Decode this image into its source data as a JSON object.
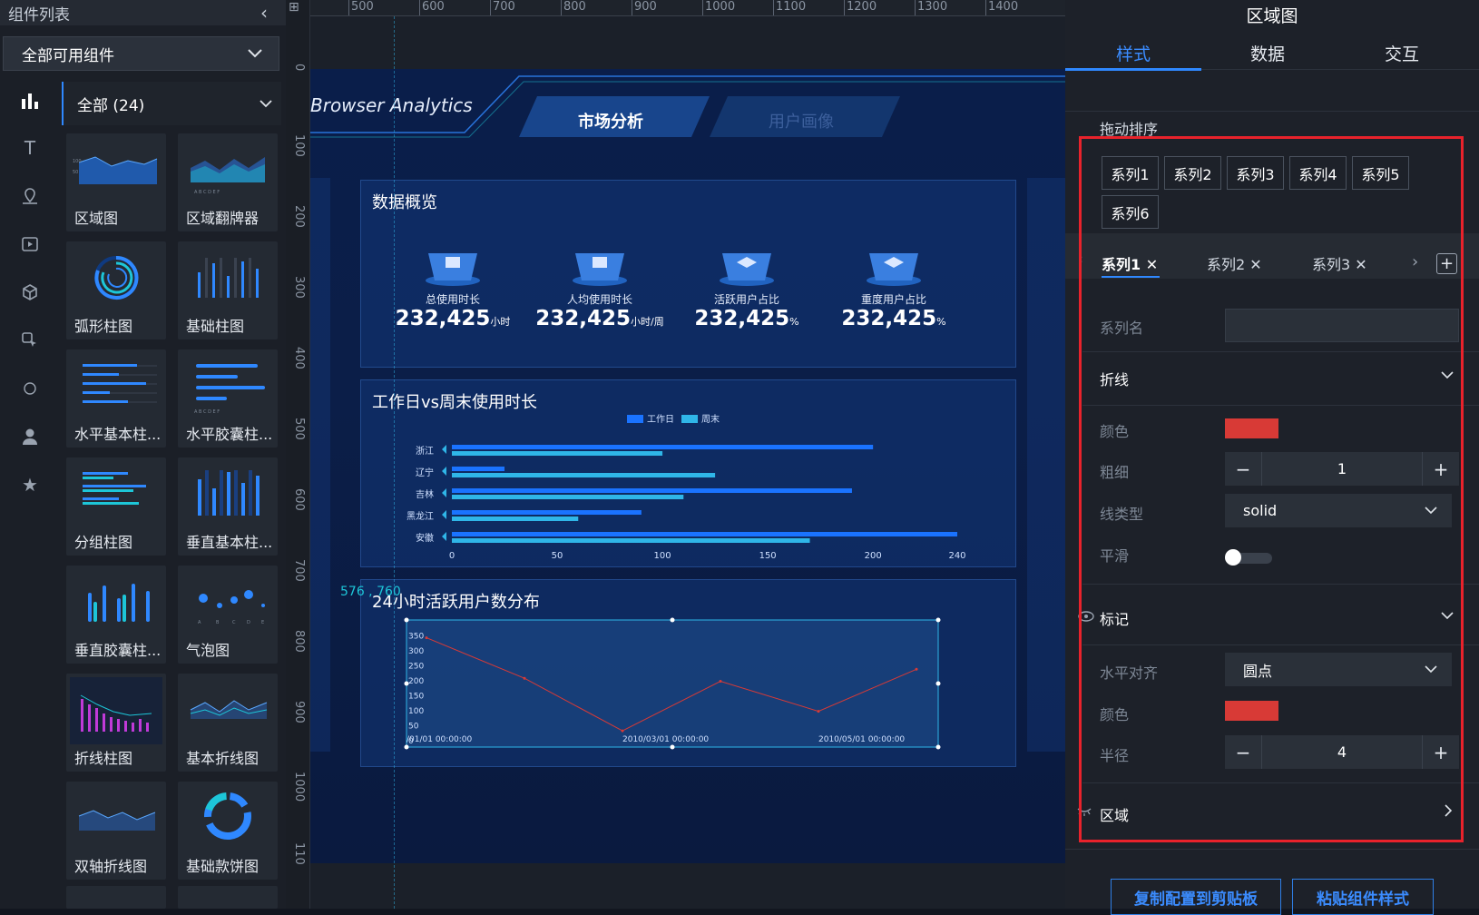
{
  "left": {
    "title": "组件列表",
    "scope_select": "全部可用组件",
    "category_select": "全部 (24)",
    "components": [
      "区域图",
      "区域翻牌器",
      "弧形柱图",
      "基础柱图",
      "水平基本柱...",
      "水平胶囊柱...",
      "分组柱图",
      "垂直基本柱...",
      "垂直胶囊柱...",
      "气泡图",
      "折线柱图",
      "基本折线图",
      "双轴折线图",
      "基础款饼图"
    ],
    "thumb_bubble_axis": [
      "A",
      "B",
      "C",
      "D",
      "E"
    ]
  },
  "ruler": {
    "h": [
      "500",
      "600",
      "700",
      "800",
      "900",
      "1000",
      "1100",
      "1200",
      "1300",
      "1400"
    ],
    "v": [
      "0",
      "100",
      "200",
      "300",
      "400",
      "500",
      "600",
      "700",
      "800",
      "900",
      "1000",
      "110"
    ]
  },
  "canvas": {
    "brand": "Browser Analytics",
    "nav_active": "市场分析",
    "nav_inactive": "用户画像",
    "overview": {
      "title": "数据概览",
      "kpis": [
        {
          "caption": "总使用时长",
          "value": "232,425",
          "unit": "小时"
        },
        {
          "caption": "人均使用时长",
          "value": "232,425",
          "unit": "小时/周"
        },
        {
          "caption": "活跃用户占比",
          "value": "232,425",
          "unit": "%"
        },
        {
          "caption": "重度用户占比",
          "value": "232,425",
          "unit": "%"
        }
      ]
    },
    "bar_title": "工作日vs周末使用时长",
    "line_title": "24小时活跃用户数分布",
    "coord_readout": "576 , 760"
  },
  "chart_data": [
    {
      "type": "bar",
      "title": "工作日vs周末使用时长",
      "orientation": "horizontal",
      "categories": [
        "浙江",
        "辽宁",
        "吉林",
        "黑龙江",
        "安徽"
      ],
      "series": [
        {
          "name": "工作日",
          "values": [
            200,
            25,
            190,
            90,
            240
          ]
        },
        {
          "name": "周末",
          "values": [
            100,
            125,
            110,
            60,
            170
          ]
        }
      ],
      "xticks": [
        "0",
        "50",
        "100",
        "150",
        "200",
        "240"
      ],
      "xlim": [
        0,
        240
      ],
      "legend": "top-center",
      "colors": [
        "#1a73ff",
        "#2fb6e8"
      ]
    },
    {
      "type": "line",
      "title": "24小时活跃用户数分布",
      "x": [
        "2010/01/01 00:00:00",
        "2010/02/01 00:00:00",
        "2010/03/01 00:00:00",
        "2010/04/01 00:00:00",
        "2010/05/01 00:00:00",
        "2010/06/01 00:00:00"
      ],
      "xtick_labels": [
        "/01/01 00:00:00",
        "2010/03/01 00:00:00",
        "2010/05/01 00:00:00"
      ],
      "series": [
        {
          "values": [
            340,
            205,
            30,
            195,
            95,
            235
          ]
        }
      ],
      "yticks": [
        "0",
        "50",
        "100",
        "150",
        "200",
        "250",
        "300",
        "350"
      ],
      "ylim": [
        0,
        375
      ],
      "color": "#d83a36"
    }
  ],
  "right": {
    "title": "区域图",
    "tabs": [
      "样式",
      "数据",
      "交互"
    ],
    "drag_sort_label": "拖动排序",
    "series_buttons": [
      "系列1",
      "系列2",
      "系列3",
      "系列4",
      "系列5",
      "系列6"
    ],
    "series_tabs": [
      "系列1",
      "系列2",
      "系列3"
    ],
    "series_name_label": "系列名",
    "series_name_value": "",
    "line_section": "折线",
    "line_color_label": "颜色",
    "line_width_label": "粗细",
    "line_width_value": "1",
    "line_type_label": "线类型",
    "line_type_value": "solid",
    "smooth_label": "平滑",
    "marker_section": "标记",
    "h_align_label": "水平对齐",
    "h_align_value": "圆点",
    "marker_color_label": "颜色",
    "radius_label": "半径",
    "radius_value": "4",
    "area_section": "区域",
    "copy_button": "复制配置到剪贴板",
    "paste_button": "粘贴组件样式",
    "colors": {
      "accent": "#2f88ff",
      "series_color": "#d83a36",
      "highlight": "#e8222b"
    }
  }
}
